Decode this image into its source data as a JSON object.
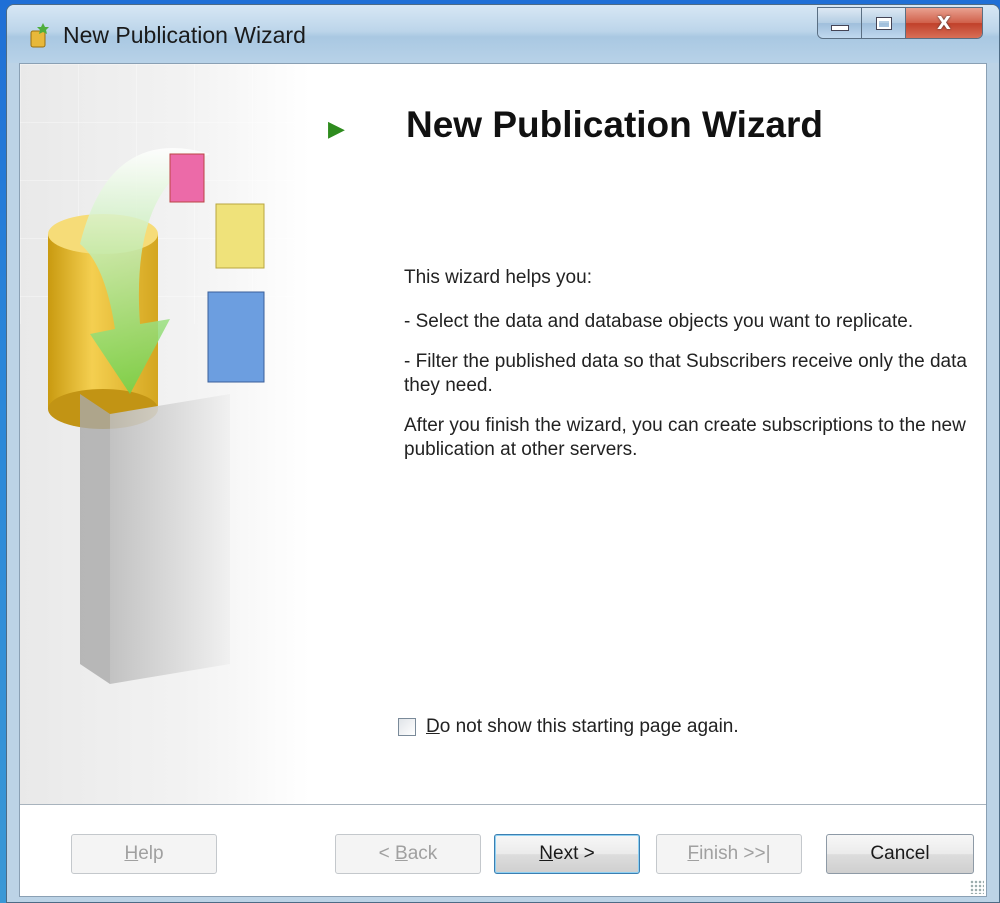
{
  "window": {
    "title": "New Publication Wizard",
    "icon": "wizard-app-icon",
    "caption_buttons": {
      "minimize": "minimize-icon",
      "maximize": "maximize-icon",
      "close": "close-icon"
    },
    "close_glyph": "X"
  },
  "page": {
    "heading": "New Publication Wizard",
    "heading_marker": "▶",
    "intro": "This wizard helps you:",
    "bullet1": "- Select the data and database objects you want to replicate.",
    "bullet2": "- Filter the published data so that Subscribers receive only the data they need.",
    "outro": "After you finish the wizard, you can create subscriptions to the new publication at other servers."
  },
  "checkbox": {
    "label_prefix": "D",
    "label_rest": "o not show this starting page again.",
    "checked": false
  },
  "buttons": {
    "help_prefix": "H",
    "help_rest": "elp",
    "back_lead": "< ",
    "back_prefix": "B",
    "back_rest": "ack",
    "next_prefix": "N",
    "next_rest": "ext >",
    "finish_prefix": "F",
    "finish_rest": "inish >>|",
    "cancel": "Cancel"
  },
  "colors": {
    "accent_arrow": "#2e8b1e",
    "desktop": "#2a86d9",
    "cancel_close": "#c0402a"
  }
}
